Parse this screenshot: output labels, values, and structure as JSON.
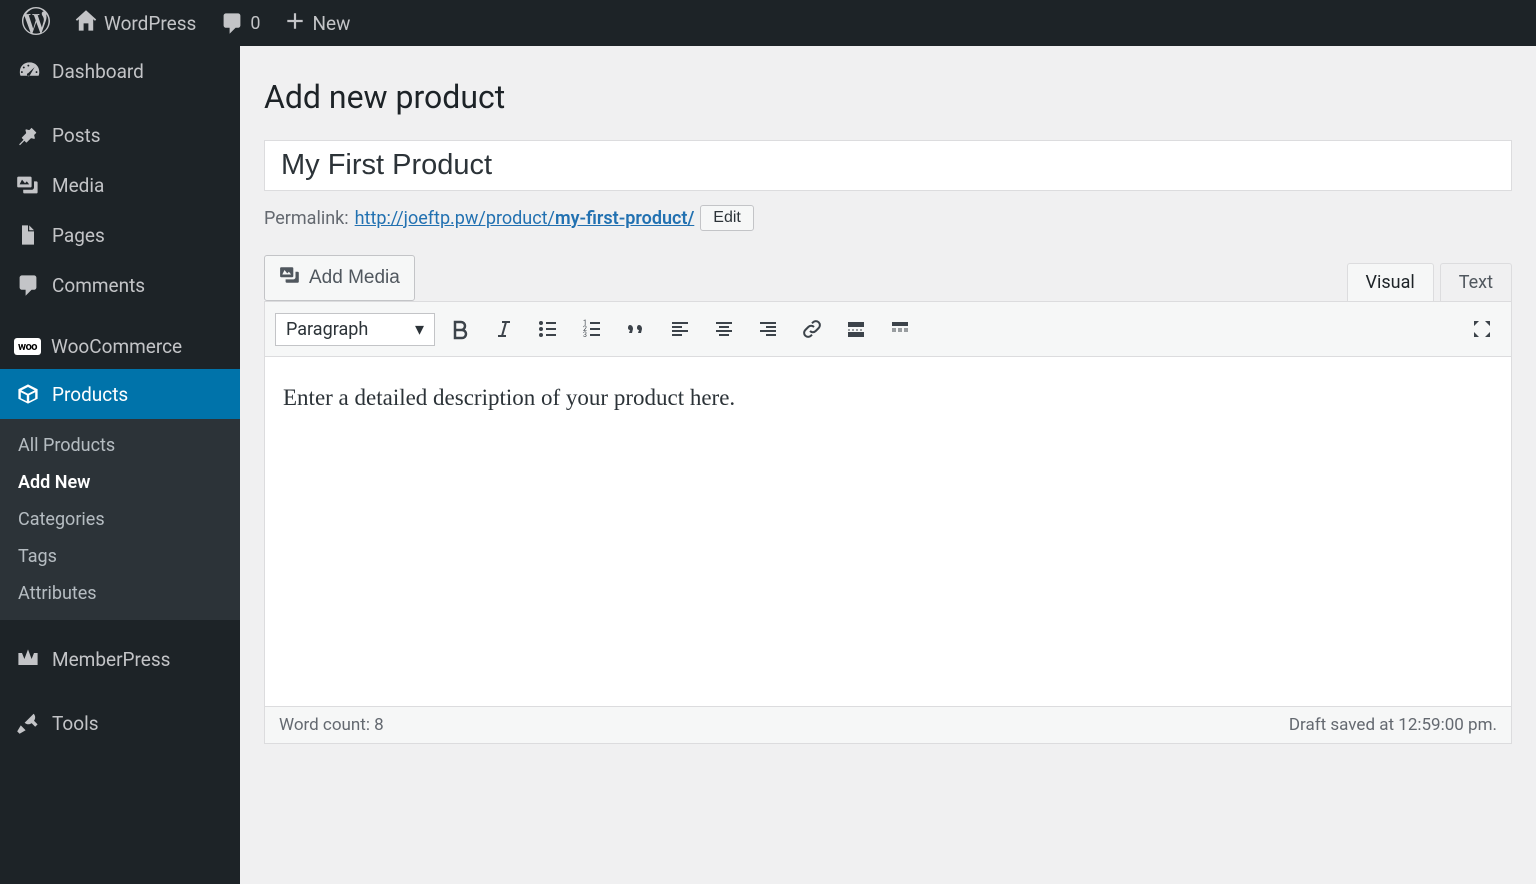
{
  "adminbar": {
    "site_name": "WordPress",
    "comment_count": "0",
    "new_label": "New"
  },
  "sidebar": {
    "items": [
      {
        "label": "Dashboard"
      },
      {
        "label": "Posts"
      },
      {
        "label": "Media"
      },
      {
        "label": "Pages"
      },
      {
        "label": "Comments"
      },
      {
        "label": "WooCommerce"
      },
      {
        "label": "Products"
      },
      {
        "label": "MemberPress"
      },
      {
        "label": "Tools"
      }
    ],
    "submenu": [
      {
        "label": "All Products"
      },
      {
        "label": "Add New"
      },
      {
        "label": "Categories"
      },
      {
        "label": "Tags"
      },
      {
        "label": "Attributes"
      }
    ]
  },
  "page": {
    "title": "Add new product",
    "product_title": "My First Product",
    "permalink_label": "Permalink:",
    "permalink_base": "http://joeftp.pw/product/",
    "permalink_slug": "my-first-product/",
    "edit_label": "Edit"
  },
  "editor": {
    "add_media_label": "Add Media",
    "tab_visual": "Visual",
    "tab_text": "Text",
    "format_label": "Paragraph",
    "content": "Enter a detailed description of your product here.",
    "word_count_label": "Word count: 8",
    "draft_saved_label": "Draft saved at 12:59:00 pm."
  }
}
